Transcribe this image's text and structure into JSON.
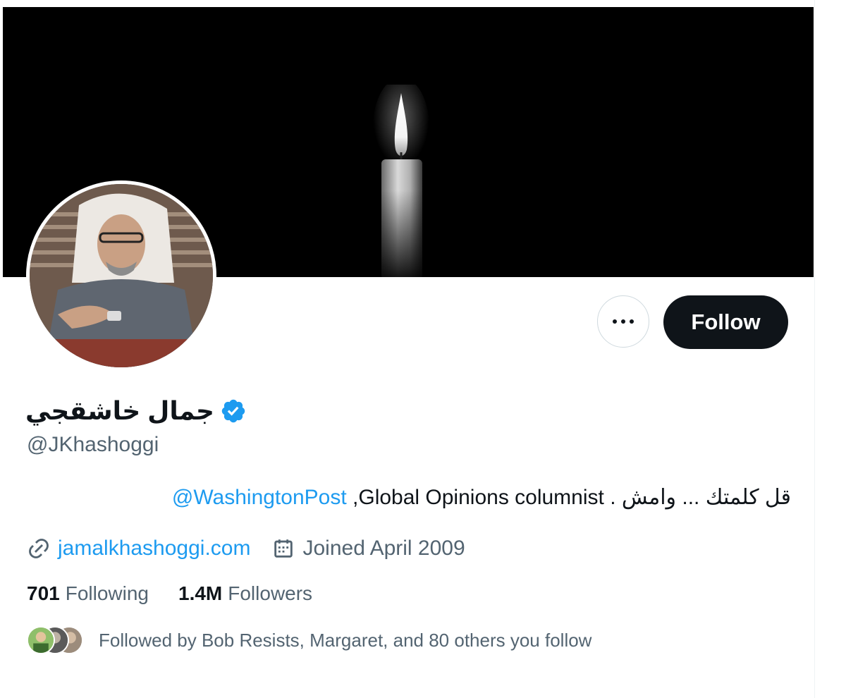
{
  "profile": {
    "display_name": "جمال خاشقجي",
    "handle": "@JKhashoggi",
    "verified": true
  },
  "actions": {
    "more_icon": "more-horizontal-icon",
    "follow_label": "Follow"
  },
  "bio": {
    "arabic_text": "قل كلمتك ... وامش .",
    "text": "Global Opinions columnist",
    "separator": ",",
    "mention": "@WashingtonPost"
  },
  "meta": {
    "website_icon": "link-icon",
    "website": "jamalkhashoggi.com",
    "joined_icon": "calendar-icon",
    "joined": "Joined April 2009"
  },
  "stats": {
    "following_count": "701",
    "following_label": "Following",
    "followers_count": "1.4M",
    "followers_label": "Followers"
  },
  "followed_by": {
    "text": "Followed by Bob Resists, Margaret, and 80 others you follow"
  },
  "colors": {
    "link": "#1d9bf0",
    "secondary_text": "#536471",
    "primary_text": "#0f1419",
    "banner": "#000000"
  }
}
